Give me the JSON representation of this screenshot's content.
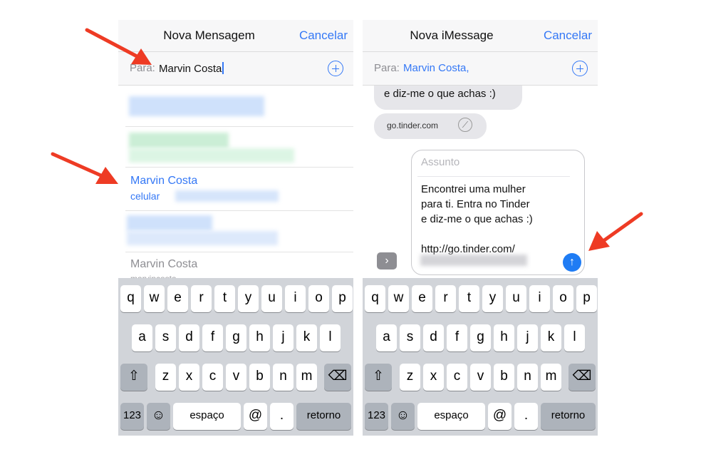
{
  "left_screen": {
    "title": "Nova Mensagem",
    "cancel": "Cancelar",
    "to_label": "Para:",
    "to_value": "Marvin Costa",
    "suggestion_name": "Marvin Costa",
    "suggestion_sub": "celular",
    "suggestion2_name": "Marvin Costa",
    "suggestion2_sub": "marvincosta..."
  },
  "right_screen": {
    "title": "Nova iMessage",
    "cancel": "Cancelar",
    "to_label": "Para:",
    "to_value": "Marvin Costa,",
    "partial_text": "para ti. Entra no Tinder\ne diz-me o que achas :)",
    "link_preview": "go.tinder.com",
    "subject_placeholder": "Assunto",
    "message_body": "Encontrei uma mulher\npara ti. Entra no Tinder\ne diz-me o que achas :)\n\nhttp://go.tinder.com/"
  },
  "keyboard": {
    "row1": [
      "q",
      "w",
      "e",
      "r",
      "t",
      "y",
      "u",
      "i",
      "o",
      "p"
    ],
    "row2": [
      "a",
      "s",
      "d",
      "f",
      "g",
      "h",
      "j",
      "k",
      "l"
    ],
    "row3": [
      "z",
      "x",
      "c",
      "v",
      "b",
      "n",
      "m"
    ],
    "numbers": "123",
    "space": "espaço",
    "at": "@",
    "dot": ".",
    "return": "retorno"
  },
  "colors": {
    "accent": "#3478f6",
    "arrow": "#ee3b24",
    "send": "#1f7cf4"
  }
}
